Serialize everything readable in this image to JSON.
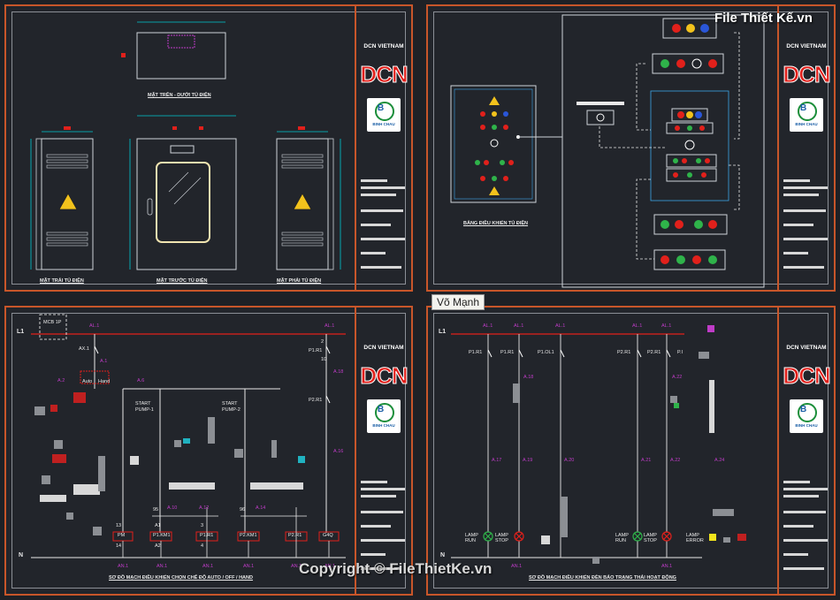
{
  "company": "DCN VIETNAM",
  "brand": "DCN",
  "logo_text": "BINH CHAU",
  "sheet1": {
    "caption_top": "MẶT TRÊN - DƯỚI TỦ ĐIỆN",
    "caption_left": "MẶT TRÁI TỦ ĐIỆN",
    "caption_front": "MẶT TRƯỚC TỦ ĐIỆN",
    "caption_right": "MẶT PHẢI TỦ ĐIỆN"
  },
  "sheet2": {
    "caption": "BẢNG ĐIỀU KHIỂN TỦ ĐIỆN"
  },
  "sheet3": {
    "caption": "SƠ ĐỒ MẠCH ĐIỀU KHIỂN CHỌN CHẾ ĐỘ AUTO / OFF / HAND",
    "l1": "L1",
    "n": "N",
    "mcb": "MCB 1P",
    "auto": "Auto",
    "hand": "Hand",
    "start1": "START",
    "pump1": "PUMP-1",
    "start2": "START",
    "pump2": "PUMP-2",
    "coils": [
      "PM",
      "P1.KM1",
      "P1.R1",
      "P2.KM1",
      "P2.R1",
      "G4Q"
    ],
    "nodes_top": [
      "AL.1",
      "AL.1"
    ],
    "node_labels": [
      "A.1",
      "A.2",
      "A.6",
      "AX.1",
      "P1.R1",
      "P2.R1",
      "A.10",
      "A.12",
      "A.14",
      "A.16",
      "A.18"
    ],
    "n_labels": [
      "AN.1",
      "AN.1",
      "AN.1",
      "AN.1",
      "AN.1",
      "AN.1"
    ],
    "contact_nums": [
      "13",
      "14",
      "A1",
      "A2",
      "3",
      "4",
      "95",
      "96",
      "2",
      "10"
    ]
  },
  "sheet4": {
    "caption": "SƠ ĐỒ MẠCH ĐIỀU KHIỂN ĐÈN BÁO TRẠNG THÁI HOẠT ĐỘNG",
    "l1": "L1",
    "n": "N",
    "top_labels": [
      "AL.1",
      "AL.1",
      "AL.1",
      "AL.1",
      "AL.1"
    ],
    "contacts": [
      "P1.R1",
      "P1.R1",
      "P1.OL1",
      "P2.R1",
      "P2.R1",
      "P.I"
    ],
    "wires": [
      "A.17",
      "A.19",
      "A.20",
      "A.21",
      "A.22",
      "A.24",
      "A.18",
      "A.22"
    ],
    "lamps": [
      "LAMP RUN",
      "LAMP STOP",
      "LAMP RUN",
      "LAMP STOP",
      "LAMP ERROR"
    ],
    "n_labels": [
      "AN.1",
      "AN.1"
    ]
  },
  "overlay_tag": "Võ Mạnh",
  "watermark_site": "File Thiết Kế.vn",
  "copyright": "Copyright © FileThietKe.vn",
  "colors": {
    "frame": "#c8562a",
    "background": "#22252b",
    "red": "#e1201b",
    "magenta": "#c03cc8",
    "green": "#2fb34a"
  }
}
